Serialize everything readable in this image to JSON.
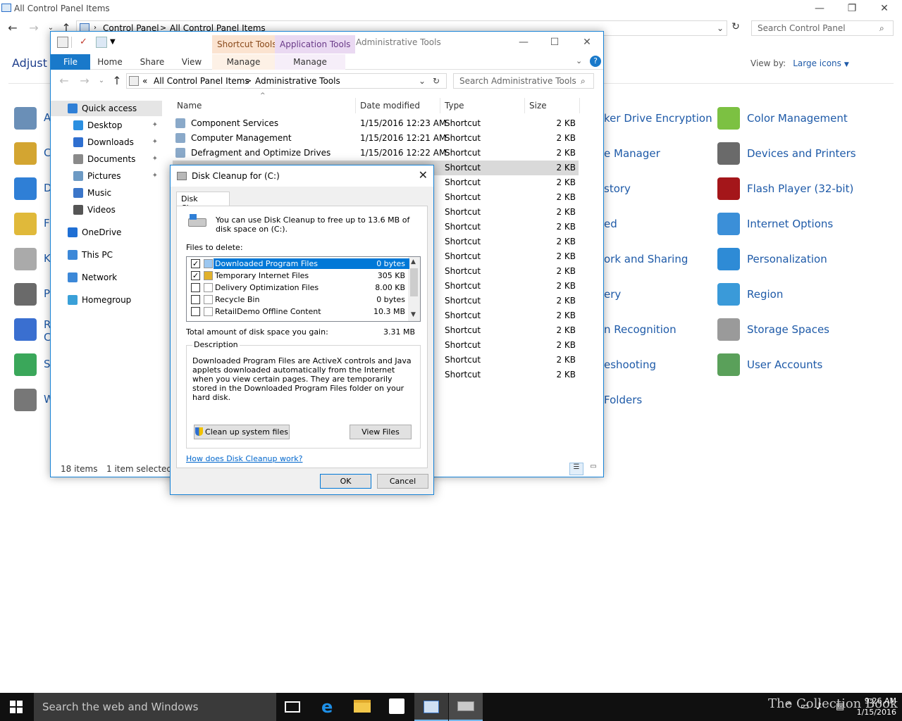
{
  "cp": {
    "title": "All Control Panel Items",
    "addr1": "Control Panel",
    "addr_sep": ">",
    "addr2": "All Control Panel Items",
    "search_ph": "Search Control Panel",
    "adjust": "Adjust y",
    "viewby_label": "View by:",
    "viewby_value": "Large icons",
    "left_items": [
      "A",
      "C",
      "D",
      "Fo",
      "K",
      "P",
      "R\nC",
      "S",
      "W"
    ],
    "mid_items": [
      "ker Drive Encryption",
      "e Manager",
      "story",
      "ed",
      "ork and Sharing",
      "ery",
      "n Recognition",
      "eshooting",
      "Folders"
    ],
    "right_items": [
      {
        "label": "Color Management",
        "icon": "color-management-icon",
        "color": "#7cc142"
      },
      {
        "label": "Devices and Printers",
        "icon": "printer-icon",
        "color": "#6a6a6a"
      },
      {
        "label": "Flash Player (32-bit)",
        "icon": "flash-icon",
        "color": "#a4161a"
      },
      {
        "label": "Internet Options",
        "icon": "globe-icon",
        "color": "#3b8fd8"
      },
      {
        "label": "Personalization",
        "icon": "monitor-icon",
        "color": "#2e8bd6"
      },
      {
        "label": "Region",
        "icon": "region-icon",
        "color": "#3a9ad9"
      },
      {
        "label": "Storage Spaces",
        "icon": "storage-icon",
        "color": "#9a9a9a"
      },
      {
        "label": "User Accounts",
        "icon": "users-icon",
        "color": "#5aa05a"
      }
    ]
  },
  "explorer": {
    "ctx1": "Shortcut Tools",
    "ctx2": "Application Tools",
    "window_title": "Administrative Tools",
    "tabs": [
      "File",
      "Home",
      "Share",
      "View"
    ],
    "manage1": "Manage",
    "manage2": "Manage",
    "addr_chev": "«",
    "addr1": "All Control Panel Items",
    "addr_sep": ">",
    "addr2": "Administrative Tools",
    "search_ph": "Search Administrative Tools",
    "nav": [
      {
        "label": "Quick access",
        "color": "#2f7fd6",
        "pin": false,
        "sel": true,
        "indent": 0
      },
      {
        "label": "Desktop",
        "color": "#2b8fe0",
        "pin": true,
        "sel": false,
        "indent": 1
      },
      {
        "label": "Downloads",
        "color": "#2f6fd0",
        "pin": true,
        "sel": false,
        "indent": 1
      },
      {
        "label": "Documents",
        "color": "#8a8a8a",
        "pin": true,
        "sel": false,
        "indent": 1
      },
      {
        "label": "Pictures",
        "color": "#6d9ac4",
        "pin": true,
        "sel": false,
        "indent": 1
      },
      {
        "label": "Music",
        "color": "#3b76c9",
        "pin": false,
        "sel": false,
        "indent": 1
      },
      {
        "label": "Videos",
        "color": "#555555",
        "pin": false,
        "sel": false,
        "indent": 1
      },
      {
        "label": "OneDrive",
        "color": "#1f6fd4",
        "pin": false,
        "sel": false,
        "indent": 0
      },
      {
        "label": "This PC",
        "color": "#3c88d8",
        "pin": false,
        "sel": false,
        "indent": 0
      },
      {
        "label": "Network",
        "color": "#3c88d8",
        "pin": false,
        "sel": false,
        "indent": 0
      },
      {
        "label": "Homegroup",
        "color": "#3aa0d8",
        "pin": false,
        "sel": false,
        "indent": 0
      }
    ],
    "columns": [
      "Name",
      "Date modified",
      "Type",
      "Size"
    ],
    "files": [
      {
        "name": "Component Services",
        "date": "1/15/2016 12:23 AM",
        "type": "Shortcut",
        "size": "2 KB"
      },
      {
        "name": "Computer Management",
        "date": "1/15/2016 12:21 AM",
        "type": "Shortcut",
        "size": "2 KB"
      },
      {
        "name": "Defragment and Optimize Drives",
        "date": "1/15/2016 12:22 AM",
        "type": "Shortcut",
        "size": "2 KB"
      }
    ],
    "extra_type": "Shortcut",
    "extra_size": "2 KB",
    "status_count": "18 items",
    "status_sel": "1 item selected"
  },
  "dialog": {
    "title": "Disk Cleanup for  (C:)",
    "tab": "Disk Cleanup",
    "info": "You can use Disk Cleanup to free up to 13.6 MB of disk space on  (C:).",
    "files_label": "Files to delete:",
    "files": [
      {
        "name": "Downloaded Program Files",
        "size": "0 bytes",
        "checked": true,
        "sel": true
      },
      {
        "name": "Temporary Internet Files",
        "size": "305 KB",
        "checked": true,
        "sel": false
      },
      {
        "name": "Delivery Optimization Files",
        "size": "8.00 KB",
        "checked": false,
        "sel": false
      },
      {
        "name": "Recycle Bin",
        "size": "0 bytes",
        "checked": false,
        "sel": false
      },
      {
        "name": "RetailDemo Offline Content",
        "size": "10.3 MB",
        "checked": false,
        "sel": false
      }
    ],
    "total_label": "Total amount of disk space you gain:",
    "total_value": "3.31 MB",
    "desc_label": "Description",
    "desc": "Downloaded Program Files are ActiveX controls and Java applets downloaded automatically from the Internet when you view certain pages. They are temporarily stored in the Downloaded Program Files folder on your hard disk.",
    "cleanup_btn": "Clean up system files",
    "view_btn": "View Files",
    "help_link": "How does Disk Cleanup work?",
    "ok": "OK",
    "cancel": "Cancel"
  },
  "taskbar": {
    "search": "Search the web and Windows",
    "time": "9:26 AM",
    "date": "1/15/2016",
    "watermark": "The Collection Book"
  }
}
